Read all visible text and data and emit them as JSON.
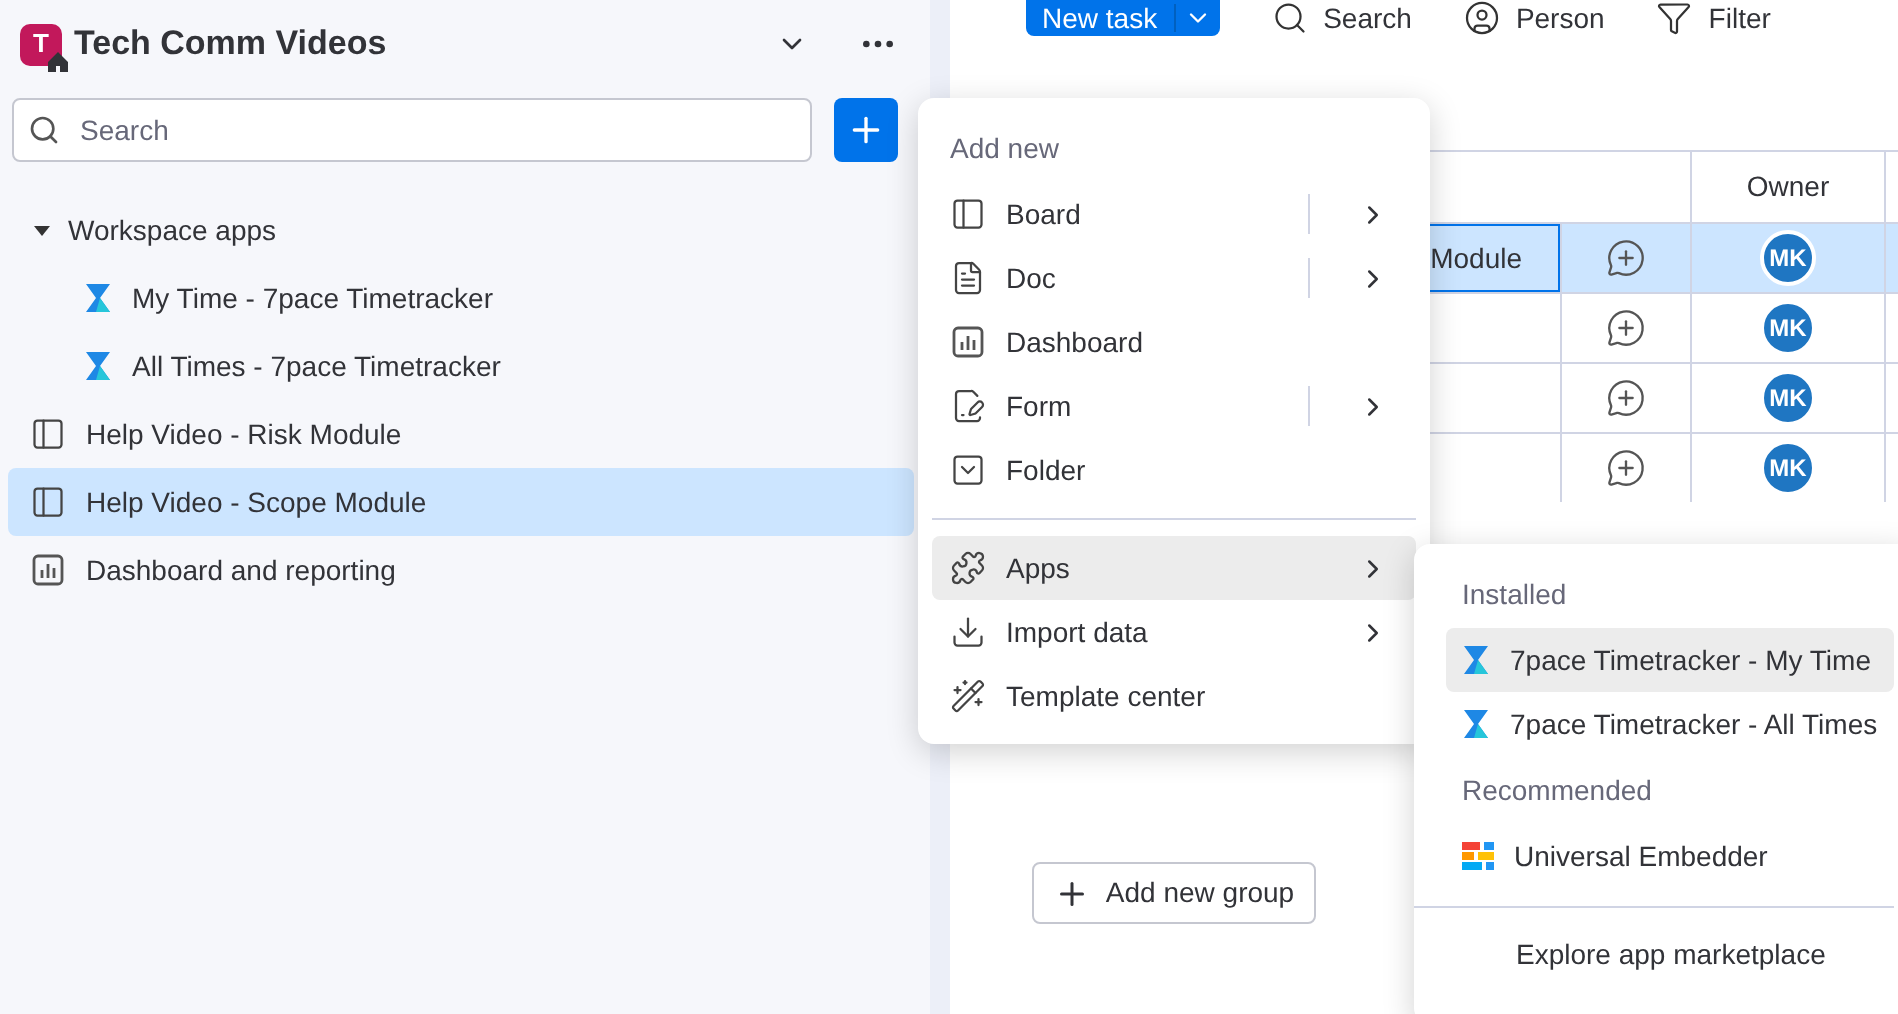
{
  "workspace": {
    "initial": "T",
    "title": "Tech Comm Videos"
  },
  "search": {
    "placeholder": "Search"
  },
  "sidebar": {
    "items": [
      {
        "kind": "folder",
        "label": "Workspace apps",
        "expanded": true,
        "selected": false,
        "children": [
          {
            "kind": "app",
            "label": "My Time - 7pace Timetracker",
            "selected": false
          },
          {
            "kind": "app",
            "label": "All Times - 7pace Timetracker",
            "selected": false
          }
        ]
      },
      {
        "kind": "board",
        "label": "Help Video - Risk Module",
        "selected": false
      },
      {
        "kind": "board",
        "label": "Help Video - Scope Module",
        "selected": true
      },
      {
        "kind": "dashboard",
        "label": "Dashboard and reporting",
        "selected": false
      }
    ]
  },
  "toolbar": {
    "new_task": "New task",
    "tools": [
      {
        "kind": "search",
        "label": "Search"
      },
      {
        "kind": "person",
        "label": "Person"
      },
      {
        "kind": "filter",
        "label": "Filter"
      }
    ]
  },
  "table": {
    "columns": [
      {
        "label": "Owner"
      }
    ],
    "rows": [
      {
        "name": "Module",
        "owner": "MK",
        "selected": true
      },
      {
        "owner": "MK",
        "selected": false
      },
      {
        "owner": "MK",
        "selected": false
      },
      {
        "owner": "MK",
        "selected": false
      }
    ]
  },
  "add_group_button": "Add new group",
  "add_menu": {
    "title": "Add new",
    "groups": [
      [
        {
          "kind": "board",
          "label": "Board",
          "submenu": true,
          "split": true,
          "selected": false
        },
        {
          "kind": "doc",
          "label": "Doc",
          "submenu": true,
          "split": true,
          "selected": false
        },
        {
          "kind": "dashboard",
          "label": "Dashboard",
          "submenu": false,
          "split": false,
          "selected": false
        },
        {
          "kind": "form",
          "label": "Form",
          "submenu": true,
          "split": true,
          "selected": false
        },
        {
          "kind": "folder",
          "label": "Folder",
          "submenu": false,
          "split": false,
          "selected": false
        }
      ],
      [
        {
          "kind": "apps",
          "label": "Apps",
          "submenu": true,
          "split": false,
          "selected": true
        },
        {
          "kind": "import",
          "label": "Import data",
          "submenu": true,
          "split": false,
          "selected": false
        },
        {
          "kind": "template",
          "label": "Template center",
          "submenu": false,
          "split": false,
          "selected": false
        }
      ]
    ]
  },
  "apps_menu": {
    "sections": [
      {
        "title": "Installed",
        "items": [
          {
            "kind": "timetracker",
            "label": "7pace Timetracker - My Time",
            "selected": true
          },
          {
            "kind": "timetracker",
            "label": "7pace Timetracker - All Times",
            "selected": false
          }
        ]
      },
      {
        "title": "Recommended",
        "items": [
          {
            "kind": "embedder",
            "label": "Universal Embedder",
            "selected": false
          }
        ]
      }
    ],
    "footer": "Explore app marketplace"
  }
}
